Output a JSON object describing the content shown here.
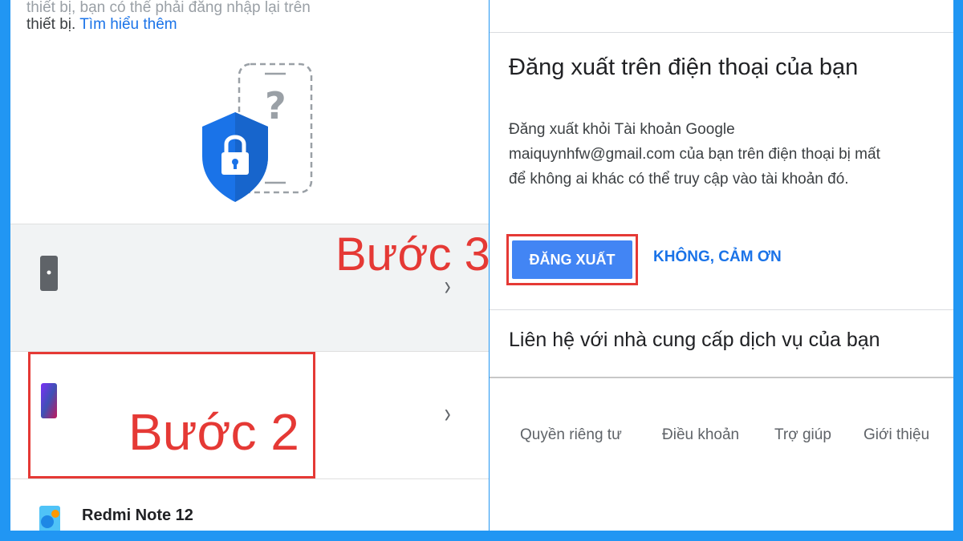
{
  "left": {
    "top_text_clipped": "thiết bị, bạn có thể phải đăng nhập lại trên",
    "top_text": "thiết bị. ",
    "learn_more": "Tìm hiểu thêm",
    "devices": [
      {
        "name": "",
        "icon": "iphone-icon"
      },
      {
        "name": "",
        "icon": "android-phone-icon"
      },
      {
        "name": "Redmi Note 12",
        "icon": "redmi-phone-icon"
      }
    ],
    "chevron": "›"
  },
  "right": {
    "title": "Đăng xuất trên điện thoại của bạn",
    "description": [
      "Đăng xuất khỏi Tài khoản Google",
      "maiquynhfw@gmail.com của bạn trên điện thoại bị mất",
      "để không ai khác có thể truy cập vào tài khoản đó."
    ],
    "signout_button": "ĐĂNG XUẤT",
    "no_thanks_button": "KHÔNG, CẢM ƠN",
    "contact_heading": "Liên hệ với nhà cung cấp dịch vụ của bạn",
    "footer": [
      "Quyền riêng tư",
      "Điều khoản",
      "Trợ giúp",
      "Giới thiệu"
    ]
  },
  "annotations": {
    "step2": "Bước 2",
    "step3": "Bước 3",
    "color": "#e53935"
  },
  "colors": {
    "frame": "#2196f3",
    "accent": "#4285f4",
    "link": "#1a73e8"
  }
}
